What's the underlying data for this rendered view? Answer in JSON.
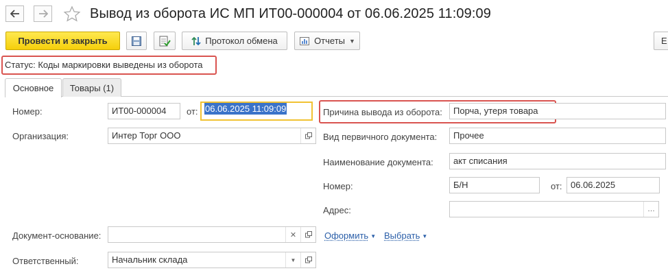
{
  "window": {
    "title": "Вывод из оборота ИС МП ИТ00-000004 от 06.06.2025 11:09:09"
  },
  "toolbar": {
    "post_close_label": "Провести и закрыть",
    "exchange_log_label": "Протокол обмена",
    "reports_label": "Отчеты",
    "edge_label": "Е"
  },
  "status": {
    "text": "Статус: Коды маркировки выведены из оборота"
  },
  "tabs": [
    {
      "label": "Основное",
      "active": true
    },
    {
      "label": "Товары (1)",
      "active": false
    }
  ],
  "form": {
    "number_label": "Номер:",
    "number_value": "ИТ00-000004",
    "date_from_label": "от:",
    "date_value": "06.06.2025 11:09:09",
    "organization_label": "Организация:",
    "organization_value": "Интер Торг ООО",
    "base_document_label": "Документ-основание:",
    "base_document_value": "",
    "responsible_label": "Ответственный:",
    "responsible_value": "Начальник склада",
    "create_link": "Оформить",
    "select_link": "Выбрать",
    "reason_label": "Причина вывода из оборота:",
    "reason_value": "Порча, утеря товара",
    "primary_doc_type_label": "Вид первичного документа:",
    "primary_doc_type_value": "Прочее",
    "doc_name_label": "Наименование документа:",
    "doc_name_value": "акт списания",
    "primary_number_label": "Номер:",
    "primary_number_value": "Б/Н",
    "primary_date_label": "от:",
    "primary_date_value": "06.06.2025",
    "address_label": "Адрес:",
    "address_value": ""
  },
  "colors": {
    "primary_button": "#f5cf0b",
    "highlight_red": "#d9534f",
    "focus_yellow": "#f1c232",
    "selection_blue": "#3a73c9",
    "link_blue": "#2a5ea8"
  }
}
